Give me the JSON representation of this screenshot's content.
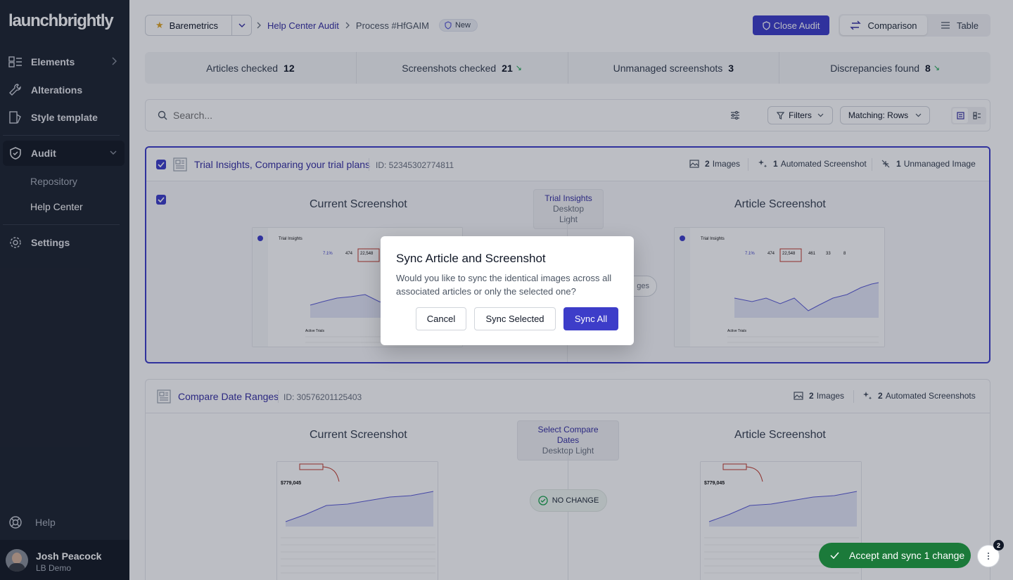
{
  "logo": "launchbrightly",
  "sidebar": {
    "items": [
      {
        "label": "Elements",
        "icon": "elements-icon"
      },
      {
        "label": "Alterations",
        "icon": "wrench-icon"
      },
      {
        "label": "Style template",
        "icon": "style-template-icon"
      },
      {
        "label": "Audit",
        "icon": "shield-check-icon"
      },
      {
        "label": "Settings",
        "icon": "gear-icon"
      }
    ],
    "sub_items": [
      "Repository",
      "Help Center"
    ],
    "help": "Help",
    "user": {
      "name": "Josh Peacock",
      "org": "LB Demo"
    }
  },
  "header": {
    "workspace": "Baremetrics",
    "breadcrumb": [
      "Help Center Audit",
      "Process #HfGAIM"
    ],
    "status_badge": "New",
    "close_audit": "Close Audit",
    "view_toggle": [
      "Comparison",
      "Table"
    ]
  },
  "stats": [
    {
      "label": "Articles checked",
      "value": "12"
    },
    {
      "label": "Screenshots checked",
      "value": "21"
    },
    {
      "label": "Unmanaged screenshots",
      "value": "3"
    },
    {
      "label": "Discrepancies found",
      "value": "8"
    }
  ],
  "search": {
    "placeholder": "Search...",
    "filters": "Filters",
    "matching": "Matching: Rows"
  },
  "cards": [
    {
      "title": "Trial Insights, Comparing your trial plans",
      "id": "ID: 52345302774811",
      "meta": [
        {
          "count": "1",
          "rest": "Unmanaged Image"
        },
        {
          "count": "1",
          "rest": "Automated Screenshot"
        },
        {
          "count": "2",
          "rest": "Images"
        }
      ],
      "current": "Current Screenshot",
      "article": "Article Screenshot",
      "variant_name": "Trial Insights",
      "variant_theme": "Desktop Light",
      "hidden_pill": "ges",
      "thumb_title": "Trial Insights",
      "thumb_stats": [
        "7.1%",
        "474",
        "22,548",
        "461",
        "33",
        "8"
      ],
      "thumb_section": "Active Trials"
    },
    {
      "title": "Compare Date Ranges",
      "id": "ID: 30576201125403",
      "meta": [
        {
          "count": "2",
          "rest": "Automated Screenshots"
        },
        {
          "count": "2",
          "rest": "Images"
        }
      ],
      "current": "Current Screenshot",
      "article": "Article Screenshot",
      "variant_name": "Select Compare Dates",
      "variant_theme": "Desktop Light",
      "status": "NO CHANGE",
      "thumb_value": "$779,045"
    }
  ],
  "modal": {
    "title": "Sync Article and Screenshot",
    "text": "Would you like to sync the identical images across all associated articles or only the selected one?",
    "cancel": "Cancel",
    "sync_selected": "Sync Selected",
    "sync_all": "Sync All"
  },
  "toast": {
    "label": "Accept and sync 1 change",
    "badge": "2"
  },
  "colors": {
    "accent": "#3d3dc9",
    "sidebar": "#1e2430",
    "success": "#1b7a3a"
  }
}
